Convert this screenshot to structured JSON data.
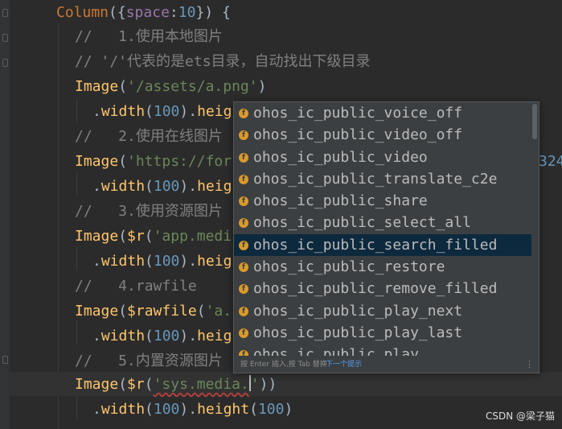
{
  "code": {
    "l1": {
      "kw": "Column",
      "p1": "({",
      "prop": "space",
      "colon": ":",
      "num": "10",
      "p2": "}) {"
    },
    "l2": {
      "cmt": "//   1.使用本地图片"
    },
    "l3": {
      "cmt": "// '/'代表的是ets目录，自动找出下级目录"
    },
    "l4": {
      "fn": "Image",
      "p1": "(",
      "str": "'/assets/a.png'",
      "p2": ")"
    },
    "l5": {
      "dot": ".",
      "fn": "width",
      "p1": "(",
      "num": "100",
      "p2": ").",
      "fn2": "heig"
    },
    "l6": {
      "cmt": "//   2.使用在线图片"
    },
    "l7": {
      "fn": "Image",
      "p1": "(",
      "str": "'https://for"
    },
    "l7_tail": {
      "num": "324"
    },
    "l8": {
      "dot": ".",
      "fn": "width",
      "p1": "(",
      "num": "100",
      "p2": ").",
      "fn2": "heig"
    },
    "l9": {
      "cmt": "//   3.使用资源图片"
    },
    "l10": {
      "fn": "Image",
      "p1": "(",
      "fn2": "$r",
      "p2": "(",
      "str": "'app.medi"
    },
    "l11": {
      "dot": ".",
      "fn": "width",
      "p1": "(",
      "num": "100",
      "p2": ").",
      "fn2": "heig"
    },
    "l12": {
      "cmt": "//   4.rawfile"
    },
    "l13": {
      "fn": "Image",
      "p1": "(",
      "fn2": "$rawfile",
      "p2": "(",
      "str": "'a."
    },
    "l14": {
      "dot": ".",
      "fn": "width",
      "p1": "(",
      "num": "100",
      "p2": ").",
      "fn2": "heig"
    },
    "l15": {
      "cmt": "//   5.内置资源图片"
    },
    "l16": {
      "fn": "Image",
      "p1": "(",
      "fn2": "$r",
      "p2": "(",
      "str_a": "'sys.media.",
      "str_b": "'",
      "p3": "))"
    },
    "l17": {
      "dot": ".",
      "fn": "width",
      "p1": "(",
      "num": "100",
      "p2": ").",
      "fn2": "height",
      "p3": "(",
      "num2": "100",
      "p4": ")"
    }
  },
  "autocomplete": {
    "items": [
      {
        "label": "ohos_ic_public_voice_off",
        "icon": "f"
      },
      {
        "label": "ohos_ic_public_video_off",
        "icon": "f"
      },
      {
        "label": "ohos_ic_public_video",
        "icon": "f"
      },
      {
        "label": "ohos_ic_public_translate_c2e",
        "icon": "f"
      },
      {
        "label": "ohos_ic_public_share",
        "icon": "f"
      },
      {
        "label": "ohos_ic_public_select_all",
        "icon": "f"
      },
      {
        "label": "ohos_ic_public_search_filled",
        "icon": "f"
      },
      {
        "label": "ohos_ic_public_restore",
        "icon": "f"
      },
      {
        "label": "ohos_ic_public_remove_filled",
        "icon": "f"
      },
      {
        "label": "ohos_ic_public_play_next",
        "icon": "f"
      },
      {
        "label": "ohos_ic_public_play_last",
        "icon": "f"
      },
      {
        "label": "ohos_ic_public_play",
        "icon": "f"
      }
    ],
    "selected_index": 6,
    "footer_hint": "按 Enter 插入,按 Tab 替换",
    "footer_next": "下一个提示",
    "footer_menu": "⋮"
  },
  "watermark": "CSDN @梁子猫",
  "colors": {
    "background": "#2b2b2b",
    "keyword": "#cc7832",
    "function": "#ffc66d",
    "string": "#6a8759",
    "number": "#6897bb",
    "comment": "#808080",
    "popup_bg": "#3c3f41",
    "selection": "#0d293e",
    "icon": "#d99a2c"
  }
}
